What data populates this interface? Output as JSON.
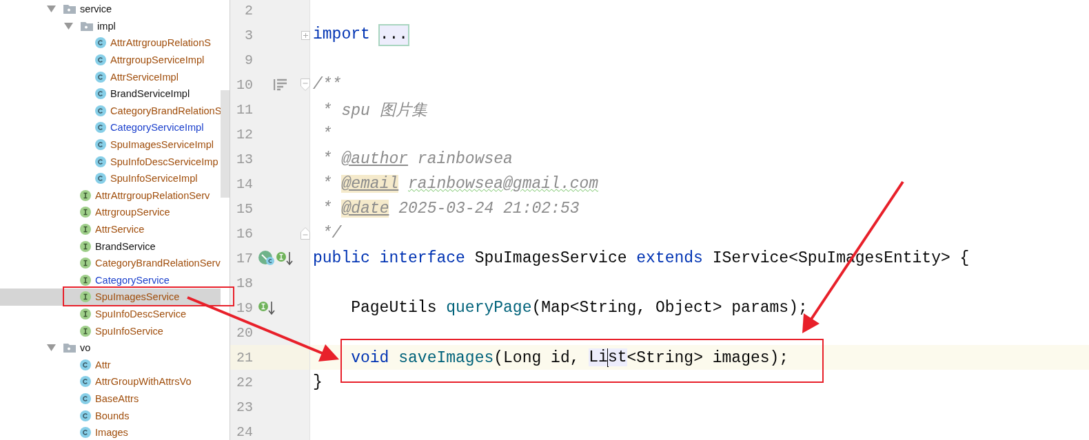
{
  "project_tree": {
    "items": [
      {
        "label": "service",
        "kind": "folder",
        "color": "#111111",
        "expanded": true,
        "selected": false,
        "children": [
          {
            "label": "impl",
            "kind": "folder",
            "color": "#111111",
            "expanded": true,
            "selected": false,
            "children": [
              {
                "label": "AttrAttrgroupRelationS",
                "kind": "class",
                "color": "#a04e0c",
                "selected": false
              },
              {
                "label": "AttrgroupServiceImpl",
                "kind": "class",
                "color": "#a04e0c",
                "selected": false
              },
              {
                "label": "AttrServiceImpl",
                "kind": "class",
                "color": "#a04e0c",
                "selected": false
              },
              {
                "label": "BrandServiceImpl",
                "kind": "class",
                "color": "#111111",
                "selected": false
              },
              {
                "label": "CategoryBrandRelationS",
                "kind": "class",
                "color": "#a04e0c",
                "selected": false
              },
              {
                "label": "CategoryServiceImpl",
                "kind": "class",
                "color": "#1a3fcc",
                "selected": false
              },
              {
                "label": "SpuImagesServiceImpl",
                "kind": "class",
                "color": "#a04e0c",
                "selected": false
              },
              {
                "label": "SpuInfoDescServiceImp",
                "kind": "class",
                "color": "#a04e0c",
                "selected": false
              },
              {
                "label": "SpuInfoServiceImpl",
                "kind": "class",
                "color": "#a04e0c",
                "selected": false
              }
            ]
          },
          {
            "label": "AttrAttrgroupRelationServ",
            "kind": "interface",
            "color": "#a04e0c",
            "selected": false
          },
          {
            "label": "AttrgroupService",
            "kind": "interface",
            "color": "#a04e0c",
            "selected": false
          },
          {
            "label": "AttrService",
            "kind": "interface",
            "color": "#a04e0c",
            "selected": false
          },
          {
            "label": "BrandService",
            "kind": "interface",
            "color": "#111111",
            "selected": false
          },
          {
            "label": "CategoryBrandRelationServ",
            "kind": "interface",
            "color": "#a04e0c",
            "selected": false
          },
          {
            "label": "CategoryService",
            "kind": "interface",
            "color": "#1a3fcc",
            "selected": false
          },
          {
            "label": "SpuImagesService",
            "kind": "interface",
            "color": "#a04e0c",
            "selected": true
          },
          {
            "label": "SpuInfoDescService",
            "kind": "interface",
            "color": "#a04e0c",
            "selected": false
          },
          {
            "label": "SpuInfoService",
            "kind": "interface",
            "color": "#a04e0c",
            "selected": false
          }
        ]
      },
      {
        "label": "vo",
        "kind": "folder",
        "color": "#111111",
        "expanded": true,
        "selected": false,
        "children": [
          {
            "label": "Attr",
            "kind": "class",
            "color": "#a04e0c",
            "selected": false
          },
          {
            "label": "AttrGroupWithAttrsVo",
            "kind": "class",
            "color": "#a04e0c",
            "selected": false
          },
          {
            "label": "BaseAttrs",
            "kind": "class",
            "color": "#a04e0c",
            "selected": false
          },
          {
            "label": "Bounds",
            "kind": "class",
            "color": "#a04e0c",
            "selected": false
          },
          {
            "label": "Images",
            "kind": "class",
            "color": "#a04e0c",
            "selected": false
          }
        ]
      }
    ]
  },
  "editor": {
    "lines": [
      {
        "number": "2",
        "current": false
      },
      {
        "number": "3",
        "current": false,
        "fold": {
          "kind": "expand"
        },
        "tokens": [
          {
            "kind": "keyword",
            "text": "import"
          },
          {
            "kind": "folded",
            "text": "..."
          }
        ]
      },
      {
        "number": "9",
        "current": false
      },
      {
        "number": "10",
        "current": false,
        "fold": {
          "kind": "start"
        },
        "markers": [
          {
            "kind": "reader-mode"
          }
        ],
        "tokens": [
          {
            "kind": "comment",
            "text": "/**"
          }
        ]
      },
      {
        "number": "11",
        "current": false,
        "tokens": [
          {
            "kind": "comment",
            "text": " * spu 图片集"
          }
        ]
      },
      {
        "number": "12",
        "current": false,
        "tokens": [
          {
            "kind": "comment",
            "text": " *"
          }
        ]
      },
      {
        "number": "13",
        "current": false,
        "tokens": [
          {
            "kind": "comment",
            "text": " * "
          },
          {
            "kind": "doctag",
            "text": "@author",
            "highlighted": false
          },
          {
            "kind": "comment",
            "text": " rainbowsea"
          }
        ]
      },
      {
        "number": "14",
        "current": false,
        "tokens": [
          {
            "kind": "comment",
            "text": " * "
          },
          {
            "kind": "doctag",
            "text": "@email",
            "highlighted": true
          },
          {
            "kind": "misspelled",
            "text": "rainbowsea@gmail.com"
          }
        ]
      },
      {
        "number": "15",
        "current": false,
        "tokens": [
          {
            "kind": "comment",
            "text": " * "
          },
          {
            "kind": "doctag",
            "text": "@date",
            "highlighted": true
          },
          {
            "kind": "comment",
            "text": " 2025-03-24 21:02:53"
          }
        ]
      },
      {
        "number": "16",
        "current": false,
        "fold": {
          "kind": "end"
        },
        "tokens": [
          {
            "kind": "comment",
            "text": " */"
          }
        ]
      },
      {
        "number": "17",
        "current": false,
        "markers": [
          {
            "kind": "implemented"
          },
          {
            "kind": "interface-down"
          }
        ],
        "tokens": [
          {
            "kind": "keyword",
            "text": "public interface"
          },
          {
            "kind": "plain",
            "text": " SpuImagesService "
          },
          {
            "kind": "keyword",
            "text": "extends"
          },
          {
            "kind": "plain",
            "text": " IService<SpuImagesEntity> {"
          }
        ]
      },
      {
        "number": "18",
        "current": false
      },
      {
        "number": "19",
        "current": false,
        "markers": [
          {
            "kind": "interface-down"
          }
        ],
        "tokens": [
          {
            "kind": "plain",
            "text": "    PageUtils "
          },
          {
            "kind": "method",
            "text": "queryPage"
          },
          {
            "kind": "plain",
            "text": "(Map<String, Object> params);"
          }
        ]
      },
      {
        "number": "20",
        "current": false
      },
      {
        "number": "21",
        "current": true,
        "tokens": [
          {
            "kind": "keyword",
            "text": "    void "
          },
          {
            "kind": "method",
            "text": "saveImages"
          },
          {
            "kind": "plain",
            "text": "(Long id, "
          },
          {
            "kind": "usage",
            "text": "Li"
          },
          {
            "kind": "caret"
          },
          {
            "kind": "usage",
            "text": "st"
          },
          {
            "kind": "plain",
            "text": "<String> images);"
          }
        ]
      },
      {
        "number": "22",
        "current": false,
        "tokens": [
          {
            "kind": "plain",
            "text": "}"
          }
        ]
      },
      {
        "number": "23",
        "current": false
      },
      {
        "number": "24",
        "current": false
      }
    ]
  }
}
